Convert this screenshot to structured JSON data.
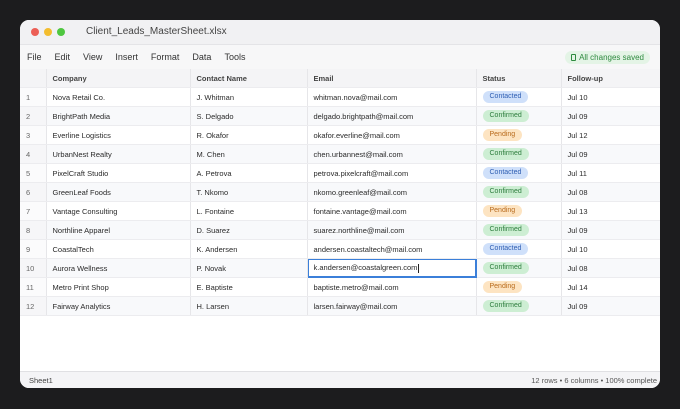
{
  "window": {
    "title": "Client_Leads_MasterSheet.xlsx"
  },
  "menu": [
    "File",
    "Edit",
    "View",
    "Insert",
    "Format",
    "Data",
    "Tools"
  ],
  "save_status": "All changes saved",
  "columns": [
    "Company",
    "Contact Name",
    "Email",
    "Status",
    "Follow-up"
  ],
  "rows": [
    {
      "n": "1",
      "company": "Nova Retail Co.",
      "contact": "J. Whitman",
      "email": "whitman.nova@mail.com",
      "status": "Contacted",
      "follow": "Jul 10"
    },
    {
      "n": "2",
      "company": "BrightPath Media",
      "contact": "S. Delgado",
      "email": "delgado.brightpath@mail.com",
      "status": "Confirmed",
      "follow": "Jul 09"
    },
    {
      "n": "3",
      "company": "Everline Logistics",
      "contact": "R. Okafor",
      "email": "okafor.everline@mail.com",
      "status": "Pending",
      "follow": "Jul 12"
    },
    {
      "n": "4",
      "company": "UrbanNest Realty",
      "contact": "M. Chen",
      "email": "chen.urbannest@mail.com",
      "status": "Confirmed",
      "follow": "Jul 09"
    },
    {
      "n": "5",
      "company": "PixelCraft Studio",
      "contact": "A. Petrova",
      "email": "petrova.pixelcraft@mail.com",
      "status": "Contacted",
      "follow": "Jul 11"
    },
    {
      "n": "6",
      "company": "GreenLeaf Foods",
      "contact": "T. Nkomo",
      "email": "nkomo.greenleaf@mail.com",
      "status": "Confirmed",
      "follow": "Jul 08"
    },
    {
      "n": "7",
      "company": "Vantage Consulting",
      "contact": "L. Fontaine",
      "email": "fontaine.vantage@mail.com",
      "status": "Pending",
      "follow": "Jul 13"
    },
    {
      "n": "8",
      "company": "Northline Apparel",
      "contact": "D. Suarez",
      "email": "suarez.northline@mail.com",
      "status": "Confirmed",
      "follow": "Jul 09"
    },
    {
      "n": "9",
      "company": "CoastalTech",
      "contact": "K. Andersen",
      "email": "andersen.coastaltech@mail.com",
      "status": "Contacted",
      "follow": "Jul 10"
    },
    {
      "n": "10",
      "company": "Aurora Wellness",
      "contact": "P. Novak",
      "email": "k.andersen@coastalgreen.com",
      "status": "Confirmed",
      "follow": "Jul 08"
    },
    {
      "n": "11",
      "company": "Metro Print Shop",
      "contact": "E. Baptiste",
      "email": "baptiste.metro@mail.com",
      "status": "Pending",
      "follow": "Jul 14"
    },
    {
      "n": "12",
      "company": "Fairway Analytics",
      "contact": "H. Larsen",
      "email": "larsen.fairway@mail.com",
      "status": "Confirmed",
      "follow": "Jul 09"
    }
  ],
  "editing_row": "10",
  "statusbar": {
    "sheet": "Sheet1",
    "summary": "12 rows • 6 columns • 100% complete"
  },
  "colors": {
    "accent": "#3b7fd9",
    "contacted": "#cfe0fa",
    "confirmed": "#cdeed3",
    "pending": "#fde4c2"
  }
}
